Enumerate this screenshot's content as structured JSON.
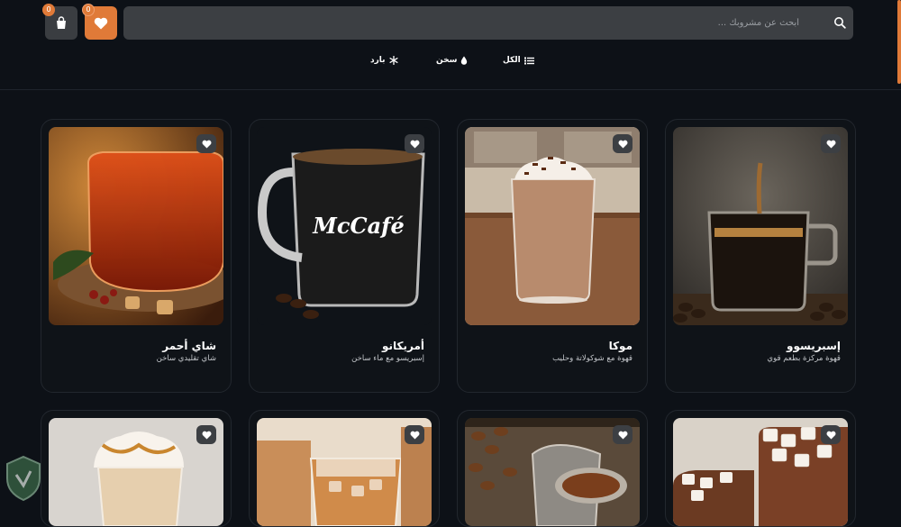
{
  "header": {
    "cart_count": "0",
    "favorites_count": "0",
    "search_placeholder": "أبحث عن مشروبك ..."
  },
  "filters": [
    {
      "label": "الكل",
      "icon": "list-icon"
    },
    {
      "label": "سخن",
      "icon": "drop-icon"
    },
    {
      "label": "بارد",
      "icon": "snowflake-icon"
    }
  ],
  "products": [
    {
      "title": "إسبريسوو",
      "desc": "قهوة مركزة بطعم قوي"
    },
    {
      "title": "موكا",
      "desc": "قهوة مع شوكولاتة وحليب"
    },
    {
      "title": "أمريكانو",
      "desc": "إسبريسو مع ماء ساخن"
    },
    {
      "title": "شاي أحمر",
      "desc": "شاي تقليدي ساخن"
    },
    {
      "title": "",
      "desc": ""
    },
    {
      "title": "",
      "desc": ""
    },
    {
      "title": "",
      "desc": ""
    },
    {
      "title": "",
      "desc": ""
    }
  ],
  "mug_logo": "McCafé",
  "colors": {
    "accent": "#e07a38",
    "background": "#0d1117",
    "card": "#0f1318",
    "control": "#3c3f43"
  }
}
